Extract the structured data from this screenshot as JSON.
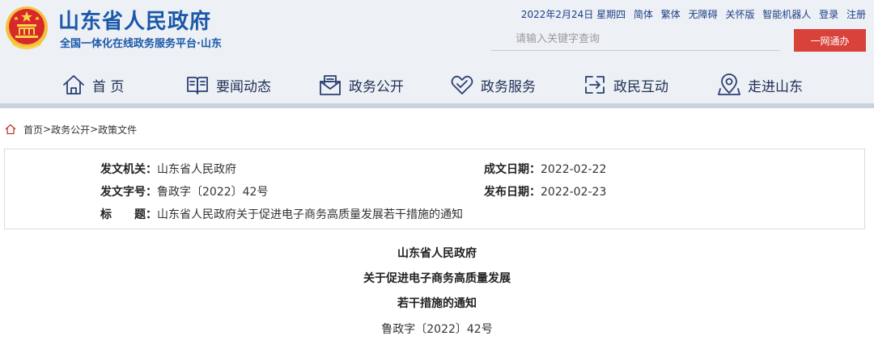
{
  "header": {
    "site_title": "山东省人民政府",
    "site_subtitle": "全国一体化在线政务服务平台·山东",
    "emblem_icon": "national-emblem-icon",
    "brand_color": "#1b58a8"
  },
  "topbar": {
    "date": "2022年2月24日 星期四",
    "links": [
      "简体",
      "繁体",
      "无障碍",
      "关怀版",
      "智能机器人",
      "登录",
      "注册"
    ]
  },
  "search": {
    "placeholder": "请输入关键字查询",
    "button_label": "一网通办",
    "button_color": "#d9423b"
  },
  "nav": {
    "items": [
      {
        "label": "首 页",
        "icon": "home-icon"
      },
      {
        "label": "要闻动态",
        "icon": "news-book-icon"
      },
      {
        "label": "政务公开",
        "icon": "envelope-icon"
      },
      {
        "label": "政务服务",
        "icon": "heart-icon"
      },
      {
        "label": "政民互动",
        "icon": "interaction-icon"
      },
      {
        "label": "走进山东",
        "icon": "map-pin-icon"
      }
    ]
  },
  "breadcrumb": {
    "icon": "home-icon",
    "items": [
      "首页",
      "政务公开",
      "政策文件"
    ],
    "separator": ">"
  },
  "meta": {
    "issuer_label": "发文机关：",
    "issuer": "山东省人民政府",
    "doc_no_label": "发文字号：",
    "doc_no": "鲁政字〔2022〕42号",
    "title_label": "标　　题：",
    "title": "山东省人民政府关于促进电子商务高质量发展若干措施的通知",
    "created_label": "成文日期：",
    "created": "2022-02-22",
    "published_label": "发布日期：",
    "published": "2022-02-23"
  },
  "document": {
    "title_lines": [
      "山东省人民政府",
      "关于促进电子商务高质量发展",
      "若干措施的通知"
    ],
    "doc_no": "鲁政字〔2022〕42号"
  }
}
